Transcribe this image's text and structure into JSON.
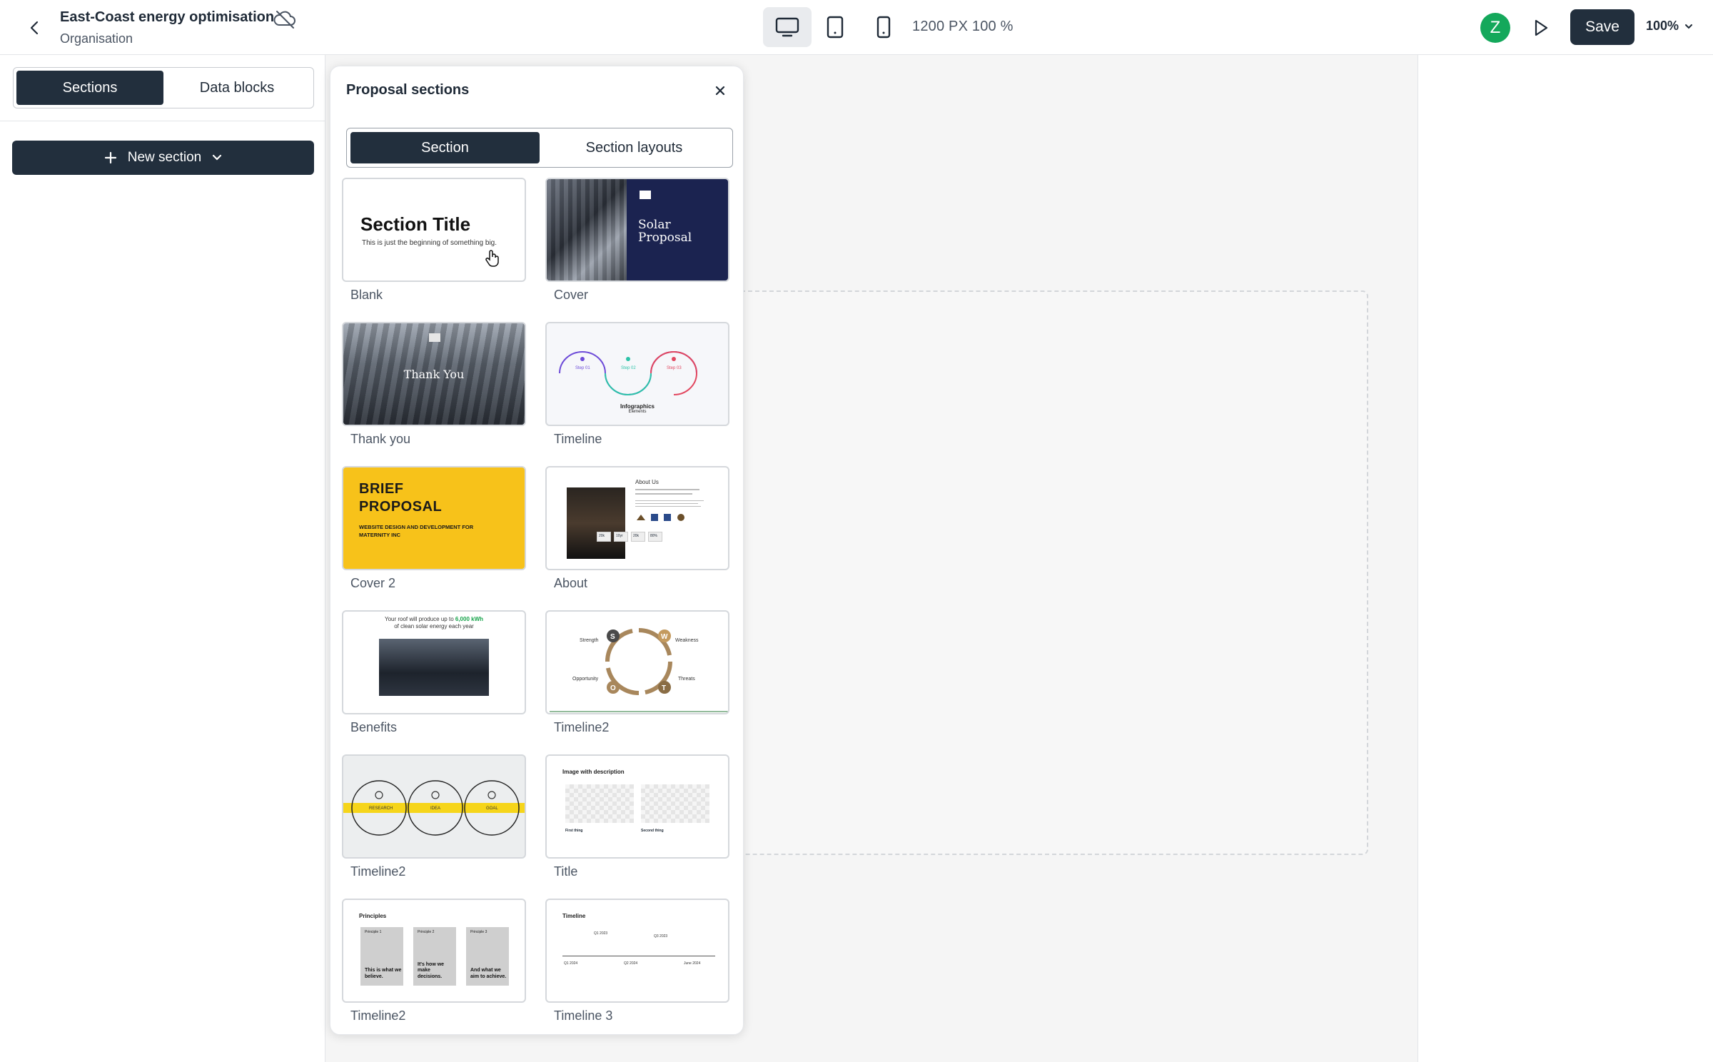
{
  "topbar": {
    "title": "East-Coast energy optimisation",
    "subtitle": "Organisation",
    "size_text": "1200 PX 100 %",
    "avatar_letter": "Z",
    "save_label": "Save",
    "zoom_label": "100%"
  },
  "sidebar": {
    "tabs": [
      {
        "label": "Sections",
        "active": true
      },
      {
        "label": "Data blocks",
        "active": false
      }
    ],
    "new_section_label": "New section"
  },
  "modal": {
    "title": "Proposal sections",
    "tabs": [
      {
        "label": "Section",
        "active": true
      },
      {
        "label": "Section layouts",
        "active": false
      }
    ],
    "cards": [
      {
        "label": "Blank"
      },
      {
        "label": "Cover"
      },
      {
        "label": "Thank you"
      },
      {
        "label": "Timeline"
      },
      {
        "label": "Cover 2"
      },
      {
        "label": "About"
      },
      {
        "label": "Benefits"
      },
      {
        "label": "Timeline2"
      },
      {
        "label": "Timeline2"
      },
      {
        "label": "Title"
      },
      {
        "label": "Timeline2"
      },
      {
        "label": "Timeline 3"
      }
    ],
    "thumbs": {
      "blank_title": "Section Title",
      "blank_sub": "This is just the beginning of something big.",
      "cover_title_1": "Solar",
      "cover_title_2": "Proposal",
      "thanks_title": "Thank You",
      "timeline_cap_1": "Infographics",
      "timeline_cap_2": "Elements",
      "timeline_steps": [
        "Step 01",
        "Step 02",
        "Step 03"
      ],
      "cover2_title_1": "BRIEF",
      "cover2_title_2": "PROPOSAL",
      "cover2_sub": "WEBSITE DESIGN AND DEVELOPMENT FOR MATERNITY INC",
      "about_title": "About Us",
      "about_stats": [
        "20k",
        "10yr",
        "20k",
        "80%"
      ],
      "benefits_pre": "Your roof will produce up to",
      "benefits_kwh": "6,000 kWh",
      "benefits_post": "of clean solar energy each year",
      "swot_letters": [
        "S",
        "W",
        "O",
        "T"
      ],
      "swot_words": [
        "Strength",
        "Weakness",
        "Opportunity",
        "Threats"
      ],
      "tl2_labels": [
        "RESEARCH",
        "IDEA",
        "GOAL"
      ],
      "title_card_heading": "Image with description",
      "title_card_items": [
        "First thing",
        "Second thing"
      ],
      "principles_heading": "Principles",
      "principles": [
        {
          "tag": "Principle 1",
          "text": "This is what we believe."
        },
        {
          "tag": "Principle 2",
          "text": "It's how we make decisions."
        },
        {
          "tag": "Principle 3",
          "text": "And what we aim to achieve."
        }
      ],
      "tl3_heading": "Timeline",
      "tl3_dates": [
        "Q1 2023",
        "Q3 2023",
        "Q1 2024",
        "Q2 2024",
        "June 2024"
      ]
    }
  },
  "colors": {
    "primary_dark": "#222f3d",
    "avatar": "#14a85b",
    "cover_navy": "#1b2350",
    "cover2_yellow": "#f7c21a"
  }
}
